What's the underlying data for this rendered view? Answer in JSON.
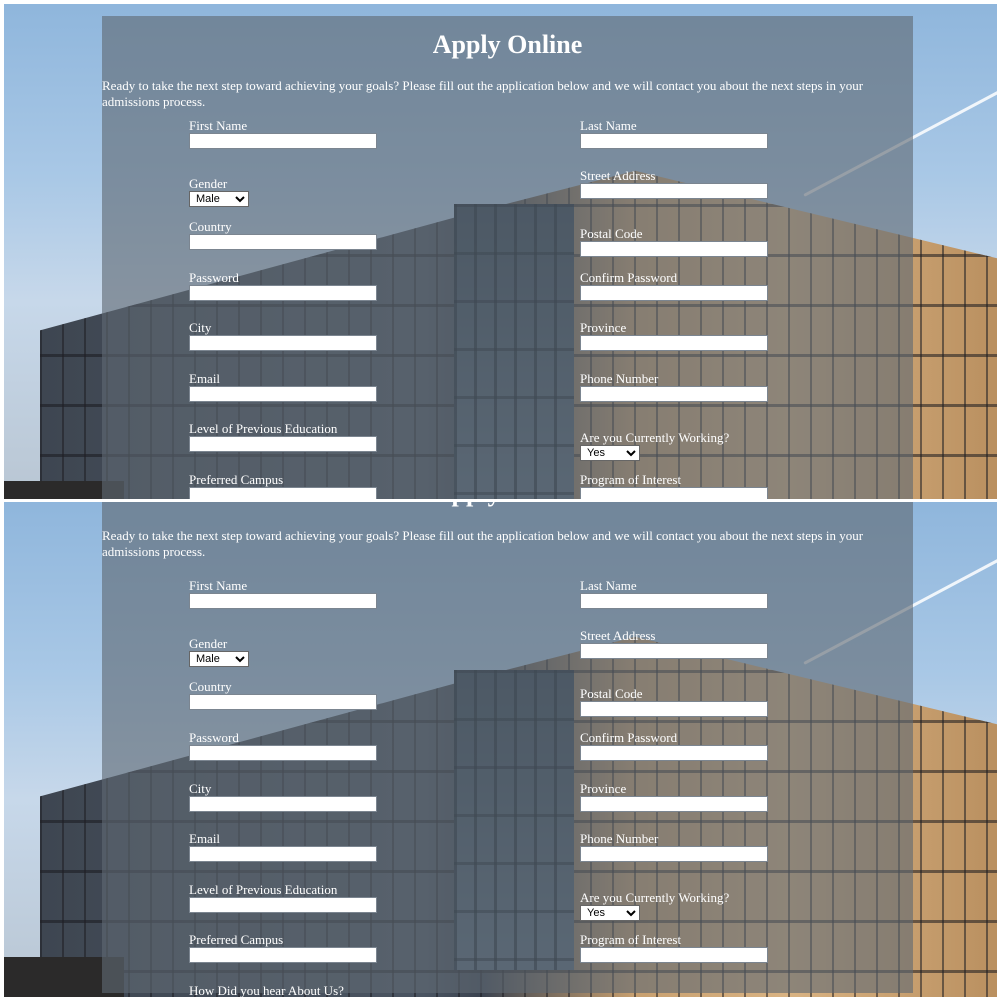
{
  "page": {
    "title": "Apply Online",
    "intro": "Ready to take the next step toward achieving your goals? Please fill out the application below and we will contact you about the next steps in your admissions process."
  },
  "form": {
    "first_name": {
      "label": "First Name",
      "value": ""
    },
    "last_name": {
      "label": "Last Name",
      "value": ""
    },
    "gender": {
      "label": "Gender",
      "selected": "Male"
    },
    "street_address": {
      "label": "Street Address",
      "value": ""
    },
    "country": {
      "label": "Country",
      "value": ""
    },
    "postal_code": {
      "label": "Postal Code",
      "value": ""
    },
    "password": {
      "label": "Password",
      "value": ""
    },
    "confirm_password": {
      "label": "Confirm Password",
      "value": ""
    },
    "city": {
      "label": "City",
      "value": ""
    },
    "province": {
      "label": "Province",
      "value": ""
    },
    "email": {
      "label": "Email",
      "value": ""
    },
    "phone_number": {
      "label": "Phone Number",
      "value": ""
    },
    "previous_education": {
      "label": "Level of Previous Education",
      "value": ""
    },
    "currently_working": {
      "label": "Are you Currently Working?",
      "selected": "Yes"
    },
    "preferred_campus": {
      "label": "Preferred Campus",
      "value": ""
    },
    "program_of_interest": {
      "label": "Program of Interest",
      "value": ""
    },
    "how_heard": {
      "label": "How Did you hear About Us?"
    }
  },
  "colors": {
    "overlay": "#5f6973",
    "text": "#ffffff"
  }
}
